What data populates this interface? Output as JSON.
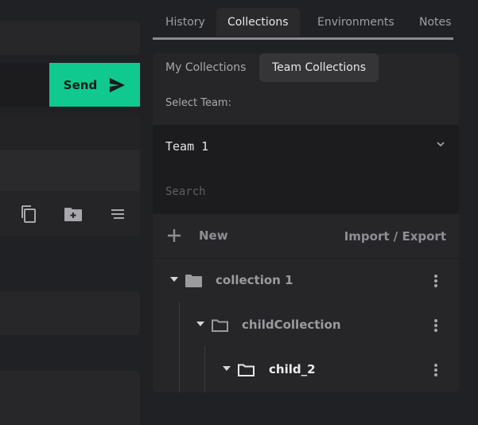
{
  "request": {
    "send_label": "Send"
  },
  "tabs": [
    {
      "label": "History",
      "active": false
    },
    {
      "label": "Collections",
      "active": true
    },
    {
      "label": "Environments",
      "active": false
    },
    {
      "label": "Notes",
      "active": false
    }
  ],
  "collections": {
    "subtabs": [
      {
        "label": "My Collections",
        "active": false
      },
      {
        "label": "Team Collections",
        "active": true
      }
    ],
    "select_team_label": "Select Team:",
    "selected_team": "Team 1",
    "search_placeholder": "Search",
    "new_label": "New",
    "import_export_label": "Import / Export",
    "tree": [
      {
        "name": "collection 1",
        "level": 0,
        "expanded": true,
        "icon": "folder-filled-icon"
      },
      {
        "name": "childCollection",
        "level": 1,
        "expanded": true,
        "icon": "folder-outline-icon"
      },
      {
        "name": "child_2",
        "level": 2,
        "expanded": true,
        "icon": "folder-outline-icon"
      }
    ]
  },
  "colors": {
    "accent": "#10c98e",
    "background": "#202124",
    "panel": "#262629"
  }
}
